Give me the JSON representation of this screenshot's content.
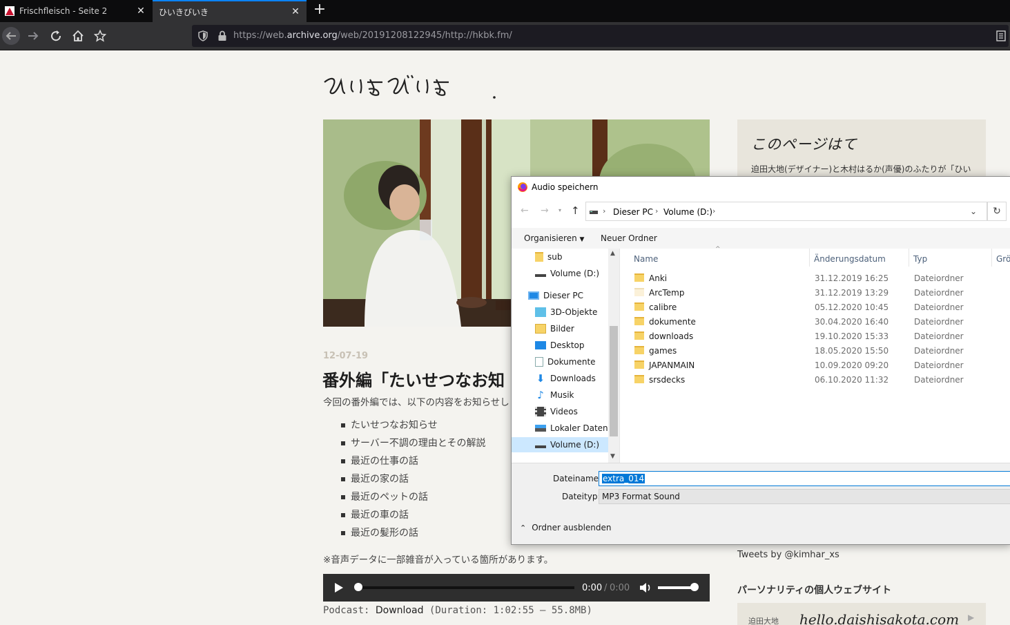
{
  "browser": {
    "tabs": [
      {
        "title": "Frischfleisch - Seite 2",
        "active": false
      },
      {
        "title": "ひいきびいき",
        "active": true
      }
    ],
    "url": {
      "prefix": "https://web.",
      "domain": "archive.org",
      "path": "/web/20191208122945/http://hkbk.fm/"
    },
    "accent": "#0a84ff"
  },
  "page": {
    "logo_text": "ひいきびいき.",
    "post": {
      "date": "12-07-19",
      "title": "番外編「たいせつなお知",
      "intro": "今回の番外編では、以下の内容をお知らせし",
      "topics": [
        "たいせつなお知らせ",
        "サーバー不調の理由とその解説",
        "最近の仕事の話",
        "最近の家の話",
        "最近のペットの話",
        "最近の車の話",
        "最近の髪形の話"
      ],
      "note": "※音声データに一部雑音が入っている箇所があります。",
      "player": {
        "current": "0:00",
        "separator": "/",
        "total": "0:00"
      },
      "podcast_label": "Podcast:",
      "download_label": "Download",
      "duration_text": "(Duration: 1:02:55 — 55.8MB)"
    },
    "sidebar": {
      "about_heading": "このページはて",
      "about_text": "迫田大地(デザイナー)と木村はるか(声優)のふたりが「ひい",
      "tweets": "Tweets by @kimhar_xs",
      "personal_heading": "パーソナリティの個人ウェブサイト",
      "card_name": "迫田大地",
      "card_handwriting": "hello.daishisakota.com"
    }
  },
  "dialog": {
    "title": "Audio speichern",
    "breadcrumb": [
      "Dieser PC",
      "Volume (D:)"
    ],
    "toolbar": {
      "organize": "Organisieren",
      "new_folder": "Neuer Ordner"
    },
    "nav_items": [
      {
        "label": "sub",
        "icon": "folder-icon"
      },
      {
        "label": "Volume (D:)",
        "icon": "drive-icon"
      },
      {
        "label": "Dieser PC",
        "icon": "computer-icon"
      },
      {
        "label": "3D-Objekte",
        "icon": "cube-icon"
      },
      {
        "label": "Bilder",
        "icon": "pictures-icon"
      },
      {
        "label": "Desktop",
        "icon": "desktop-icon"
      },
      {
        "label": "Dokumente",
        "icon": "documents-icon"
      },
      {
        "label": "Downloads",
        "icon": "download-icon"
      },
      {
        "label": "Musik",
        "icon": "music-icon"
      },
      {
        "label": "Videos",
        "icon": "video-icon"
      },
      {
        "label": "Lokaler Datenträ",
        "icon": "drive-icon"
      },
      {
        "label": "Volume (D:)",
        "icon": "drive-icon",
        "selected": true
      }
    ],
    "columns": {
      "name": "Name",
      "date": "Änderungsdatum",
      "type": "Typ",
      "size": "Grö"
    },
    "files": [
      {
        "name": "Anki",
        "date": "31.12.2019 16:25",
        "type": "Dateiordner"
      },
      {
        "name": "ArcTemp",
        "date": "31.12.2019 13:29",
        "type": "Dateiordner"
      },
      {
        "name": "calibre",
        "date": "05.12.2020 10:45",
        "type": "Dateiordner"
      },
      {
        "name": "dokumente",
        "date": "30.04.2020 16:40",
        "type": "Dateiordner"
      },
      {
        "name": "downloads",
        "date": "19.10.2020 15:33",
        "type": "Dateiordner"
      },
      {
        "name": "games",
        "date": "18.05.2020 15:50",
        "type": "Dateiordner"
      },
      {
        "name": "JAPANMAIN",
        "date": "10.09.2020 09:20",
        "type": "Dateiordner"
      },
      {
        "name": "srsdecks",
        "date": "06.10.2020 11:32",
        "type": "Dateiordner"
      }
    ],
    "filename_label": "Dateiname:",
    "filename_value": "extra_014",
    "filetype_label": "Dateityp:",
    "filetype_value": "MP3 Format Sound",
    "hide_folders": "Ordner ausblenden"
  }
}
